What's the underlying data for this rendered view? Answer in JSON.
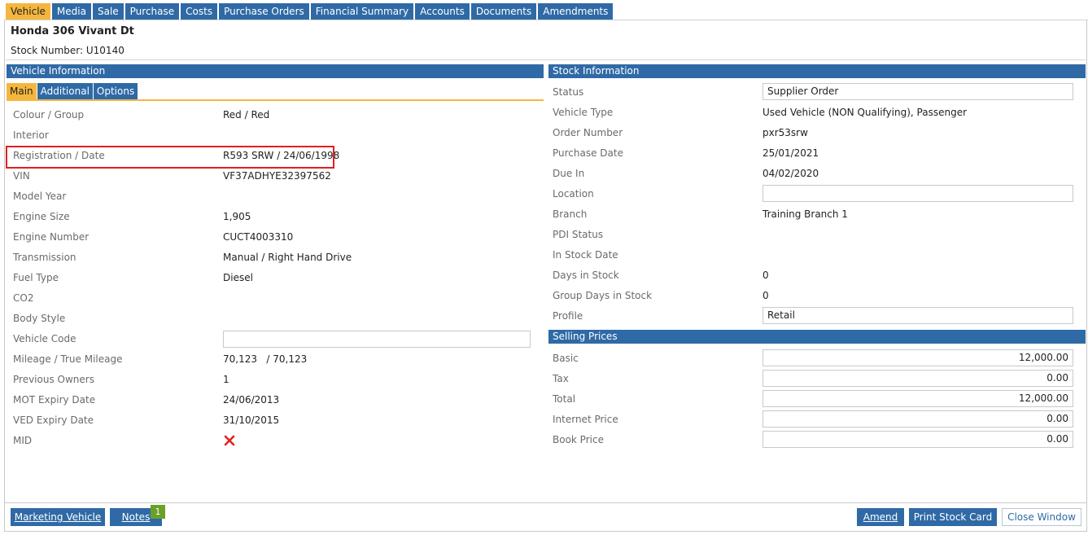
{
  "tabs": [
    "Vehicle",
    "Media",
    "Sale",
    "Purchase",
    "Costs",
    "Purchase Orders",
    "Financial Summary",
    "Accounts",
    "Documents",
    "Amendments"
  ],
  "title": "Honda 306 Vivant Dt",
  "stock_number": "Stock Number: U10140",
  "vehicle_info": {
    "header": "Vehicle Information",
    "subtabs": [
      "Main",
      "Additional",
      "Options"
    ],
    "rows": [
      {
        "label": "Colour / Group",
        "value": "Red / Red"
      },
      {
        "label": "Interior",
        "value": ""
      },
      {
        "label": "Registration / Date",
        "value": "R593 SRW / 24/06/1998"
      },
      {
        "label": "VIN",
        "value": "VF37ADHYE32397562"
      },
      {
        "label": "Model Year",
        "value": ""
      },
      {
        "label": "Engine Size",
        "value": "1,905"
      },
      {
        "label": "Engine Number",
        "value": "CUCT4003310"
      },
      {
        "label": "Transmission",
        "value": "Manual / Right Hand Drive"
      },
      {
        "label": "Fuel Type",
        "value": "Diesel"
      },
      {
        "label": "CO2",
        "value": ""
      },
      {
        "label": "Body Style",
        "value": ""
      },
      {
        "label": "Vehicle Code",
        "value": ""
      },
      {
        "label": "Mileage / True Mileage",
        "value": "70,123   / 70,123"
      },
      {
        "label": "Previous Owners",
        "value": "1"
      },
      {
        "label": "MOT Expiry Date",
        "value": "24/06/2013"
      },
      {
        "label": "VED Expiry Date",
        "value": "31/10/2015"
      },
      {
        "label": "MID",
        "value": ""
      }
    ],
    "mid_icon": "red-cross-icon"
  },
  "stock_info": {
    "header": "Stock Information",
    "rows": [
      {
        "label": "Status",
        "value": "Supplier Order"
      },
      {
        "label": "Vehicle Type",
        "value": "Used Vehicle (NON Qualifying), Passenger"
      },
      {
        "label": "Order Number",
        "value": "pxr53srw"
      },
      {
        "label": "Purchase Date",
        "value": "25/01/2021"
      },
      {
        "label": "Due In",
        "value": "04/02/2020"
      },
      {
        "label": "Location",
        "value": ""
      },
      {
        "label": "Branch",
        "value": "Training Branch 1"
      },
      {
        "label": "PDI Status",
        "value": ""
      },
      {
        "label": "In Stock Date",
        "value": ""
      },
      {
        "label": "Days in Stock",
        "value": "0"
      },
      {
        "label": "Group Days in Stock",
        "value": "0"
      },
      {
        "label": "Profile",
        "value": "Retail"
      }
    ]
  },
  "selling_prices": {
    "header": "Selling Prices",
    "rows": [
      {
        "label": "Basic",
        "value": "12,000.00"
      },
      {
        "label": "Tax",
        "value": "0.00"
      },
      {
        "label": "Total",
        "value": "12,000.00"
      },
      {
        "label": "Internet Price",
        "value": "0.00"
      },
      {
        "label": "Book Price",
        "value": "0.00"
      }
    ]
  },
  "buttons": {
    "marketing_vehicle": "Marketing Vehicle",
    "notes": "Notes",
    "notes_count": "1",
    "amend": "Amend",
    "print_stock_card": "Print Stock Card",
    "close_window": "Close Window"
  },
  "colors": {
    "accent_blue": "#2f6aa6",
    "active_tab": "#f5b63e",
    "highlight_red": "#e02020",
    "badge_green": "#6aa028"
  }
}
